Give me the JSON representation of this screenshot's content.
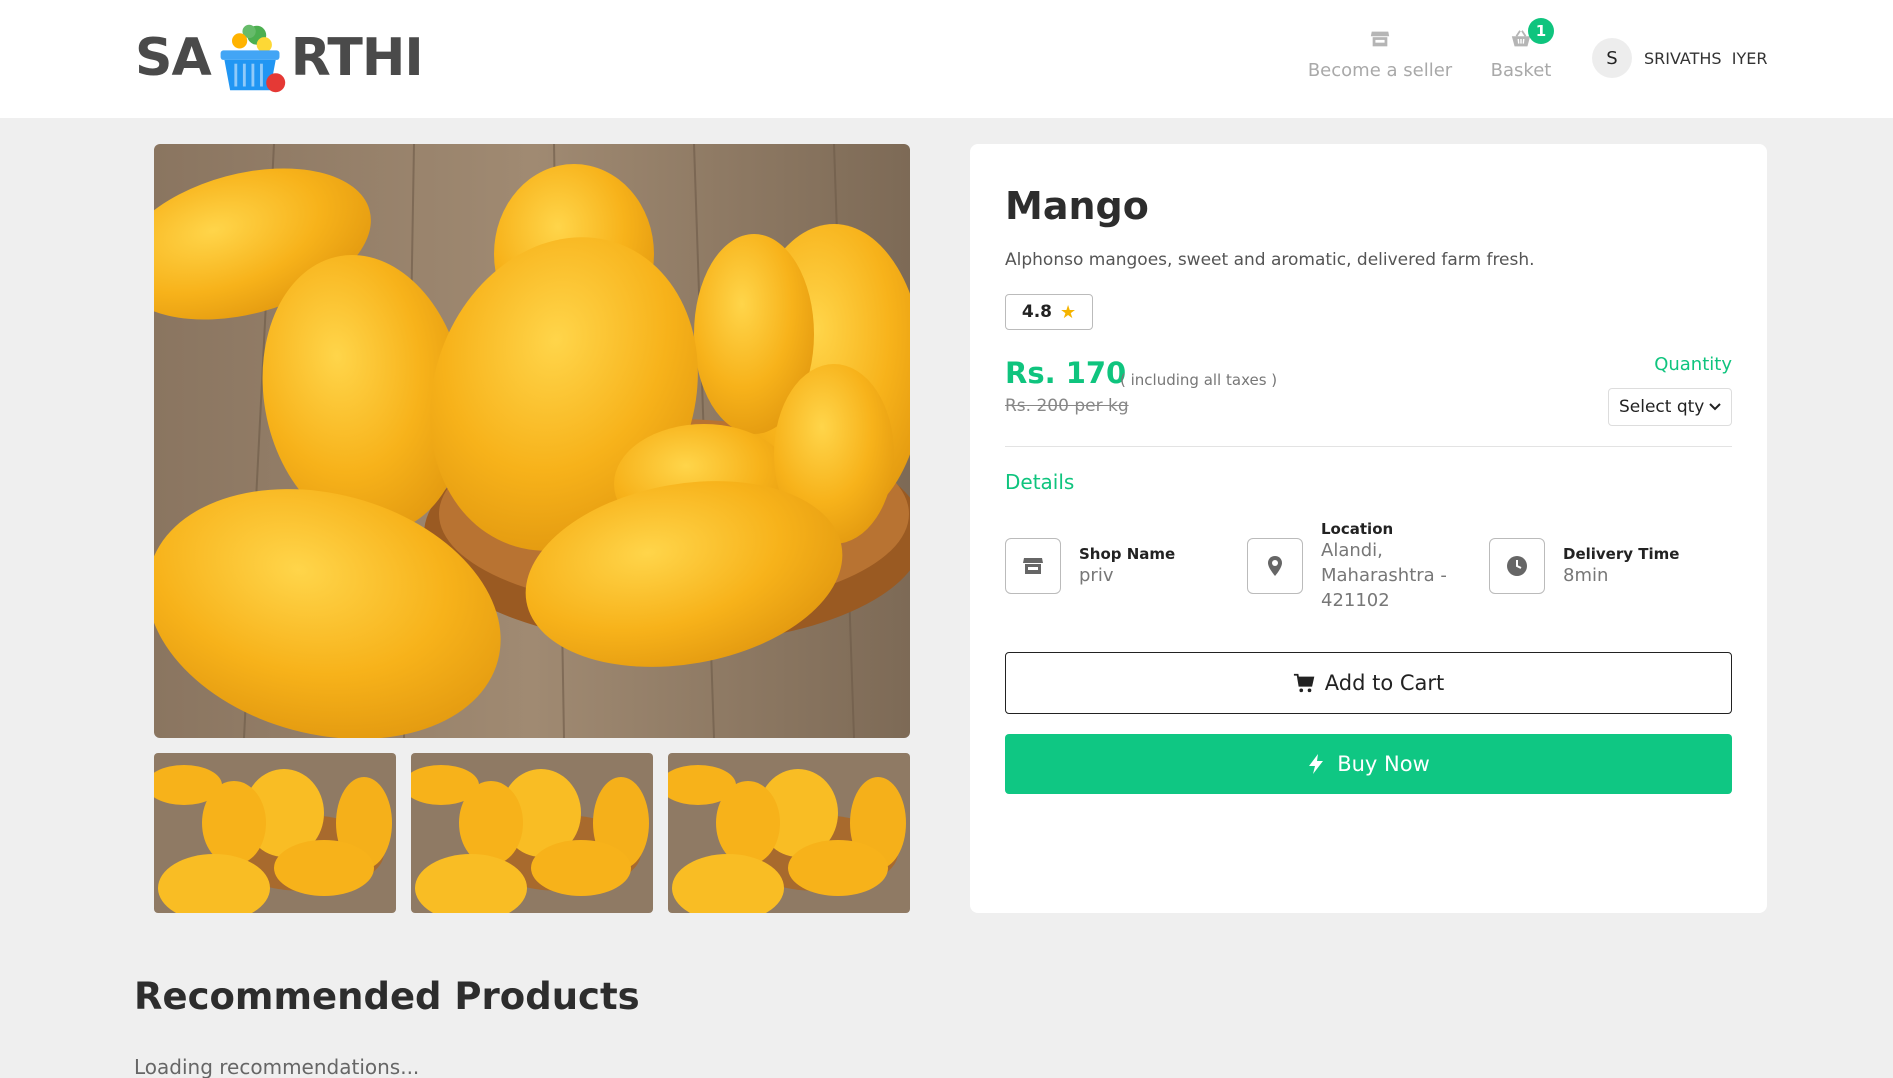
{
  "header": {
    "logo_left": "SA",
    "logo_right": "RTHI",
    "nav": {
      "seller_label": "Become a seller",
      "basket_label": "Basket",
      "basket_count": "1"
    },
    "user": {
      "initial": "S",
      "name": "SRIVATHS  IYER"
    }
  },
  "product": {
    "title": "Mango",
    "description": "Alphonso mangoes, sweet and aromatic, delivered farm fresh.",
    "rating": "4.8",
    "price": "Rs. 170",
    "tax_note": "( including all taxes )",
    "original_price": "Rs. 200 per kg",
    "quantity_label": "Quantity",
    "quantity_select": "Select qty"
  },
  "details": {
    "heading": "Details",
    "shop_label": "Shop Name",
    "shop_value": "priv",
    "location_label": "Location",
    "location_value": "Alandi, Maharashtra - 421102",
    "delivery_label": "Delivery Time",
    "delivery_value": "8min"
  },
  "actions": {
    "add_to_cart": "Add to Cart",
    "buy_now": "Buy Now"
  },
  "recommended": {
    "title": "Recommended Products",
    "status": "Loading recommendations..."
  },
  "colors": {
    "accent": "#0fc47e",
    "header_bg": "#ffffff",
    "page_bg": "#efefef"
  }
}
